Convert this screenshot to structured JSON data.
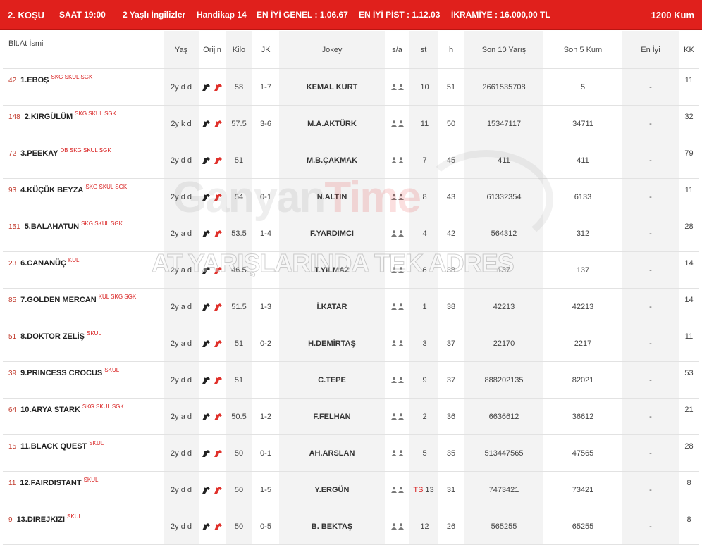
{
  "header": {
    "race": "2. KOŞU",
    "time": "SAAT 19:00",
    "category": "2 Yaşlı İngilizler",
    "handicap": "Handikap 14",
    "best_general": "EN İYİ GENEL : 1.06.67",
    "best_track": "EN İYİ PİST : 1.12.03",
    "prize": "İKRAMİYE : 16.000,00 TL",
    "distance": "1200 Kum"
  },
  "columns": {
    "name": "Blt.At İsmi",
    "age": "Yaş",
    "origin": "Orijin",
    "weight": "Kilo",
    "jk": "JK",
    "jockey": "Jokey",
    "sa": "s/a",
    "st": "st",
    "h": "h",
    "last10": "Son 10 Yarış",
    "last5": "Son 5 Kum",
    "best": "En İyi",
    "kk": "KK"
  },
  "watermark": {
    "logo_part1": "Ganyan",
    "logo_part2": "Time",
    "slogan": "AT YARIŞLARINDA TEK ADRES"
  },
  "colors": {
    "accent": "#e0201c",
    "tag": "#d81e1e",
    "shade": "#f3f3f3"
  },
  "icons": {
    "origin": [
      "horse-head-icon",
      "horse-head-red-icon"
    ],
    "sa": [
      "person-icon",
      "person-icon"
    ]
  },
  "horses": [
    {
      "no": "42",
      "name": "1.EBOŞ",
      "tags": "SKG SKUL SGK",
      "age": "2y d d",
      "weight": "58",
      "jk": "1-7",
      "jockey": "KEMAL KURT",
      "ts": "",
      "st": "10",
      "h": "51",
      "last10": "2661535708",
      "last5": "5",
      "best": "-",
      "kk": "11"
    },
    {
      "no": "148",
      "name": "2.KIRGÜLÜM",
      "tags": "SKG SKUL SGK",
      "age": "2y k d",
      "weight": "57.5",
      "jk": "3-6",
      "jockey": "M.A.AKTÜRK",
      "ts": "",
      "st": "11",
      "h": "50",
      "last10": "15347117",
      "last5": "34711",
      "best": "-",
      "kk": "32"
    },
    {
      "no": "72",
      "name": "3.PEEKAY",
      "tags": "DB SKG SKUL SGK",
      "age": "2y d d",
      "weight": "51",
      "jk": "",
      "jockey": "M.B.ÇAKMAK",
      "ts": "",
      "st": "7",
      "h": "45",
      "last10": "411",
      "last5": "411",
      "best": "-",
      "kk": "79"
    },
    {
      "no": "93",
      "name": "4.KÜÇÜK BEYZA",
      "tags": "SKG SKUL SGK",
      "age": "2y d d",
      "weight": "54",
      "jk": "0-1",
      "jockey": "N.ALTIN",
      "ts": "",
      "st": "8",
      "h": "43",
      "last10": "61332354",
      "last5": "6133",
      "best": "-",
      "kk": "11"
    },
    {
      "no": "151",
      "name": "5.BALAHATUN",
      "tags": "SKG SKUL SGK",
      "age": "2y a d",
      "weight": "53.5",
      "jk": "1-4",
      "jockey": "F.YARDIMCI",
      "ts": "",
      "st": "4",
      "h": "42",
      "last10": "564312",
      "last5": "312",
      "best": "-",
      "kk": "28"
    },
    {
      "no": "23",
      "name": "6.CANANÜÇ",
      "tags": "KUL",
      "age": "2y a d",
      "weight": "46.5",
      "jk": "",
      "jockey": "T.YILMAZ",
      "ts": "",
      "st": "6",
      "h": "38",
      "last10": "137",
      "last5": "137",
      "best": "-",
      "kk": "14"
    },
    {
      "no": "85",
      "name": "7.GOLDEN MERCAN",
      "tags": "KUL SKG SGK",
      "age": "2y a d",
      "weight": "51.5",
      "jk": "1-3",
      "jockey": "İ.KATAR",
      "ts": "",
      "st": "1",
      "h": "38",
      "last10": "42213",
      "last5": "42213",
      "best": "-",
      "kk": "14"
    },
    {
      "no": "51",
      "name": "8.DOKTOR ZELİŞ",
      "tags": "SKUL",
      "age": "2y a d",
      "weight": "51",
      "jk": "0-2",
      "jockey": "H.DEMİRTAŞ",
      "ts": "",
      "st": "3",
      "h": "37",
      "last10": "22170",
      "last5": "2217",
      "best": "-",
      "kk": "11"
    },
    {
      "no": "39",
      "name": "9.PRINCESS CROCUS",
      "tags": "SKUL",
      "age": "2y d d",
      "weight": "51",
      "jk": "",
      "jockey": "C.TEPE",
      "ts": "",
      "st": "9",
      "h": "37",
      "last10": "888202135",
      "last5": "82021",
      "best": "-",
      "kk": "53"
    },
    {
      "no": "64",
      "name": "10.ARYA STARK",
      "tags": "SKG SKUL SGK",
      "age": "2y a d",
      "weight": "50.5",
      "jk": "1-2",
      "jockey": "F.FELHAN",
      "ts": "",
      "st": "2",
      "h": "36",
      "last10": "6636612",
      "last5": "36612",
      "best": "-",
      "kk": "21"
    },
    {
      "no": "15",
      "name": "11.BLACK QUEST",
      "tags": "SKUL",
      "age": "2y d d",
      "weight": "50",
      "jk": "0-1",
      "jockey": "AH.ARSLAN",
      "ts": "",
      "st": "5",
      "h": "35",
      "last10": "513447565",
      "last5": "47565",
      "best": "-",
      "kk": "28"
    },
    {
      "no": "11",
      "name": "12.FAIRDISTANT",
      "tags": "SKUL",
      "age": "2y d d",
      "weight": "50",
      "jk": "1-5",
      "jockey": "Y.ERGÜN",
      "ts": "TS",
      "st": "13",
      "h": "31",
      "last10": "7473421",
      "last5": "73421",
      "best": "-",
      "kk": "8"
    },
    {
      "no": "9",
      "name": "13.DIREJKIZI",
      "tags": "SKUL",
      "age": "2y d d",
      "weight": "50",
      "jk": "0-5",
      "jockey": "B. BEKTAŞ",
      "ts": "",
      "st": "12",
      "h": "26",
      "last10": "565255",
      "last5": "65255",
      "best": "-",
      "kk": "8"
    }
  ]
}
